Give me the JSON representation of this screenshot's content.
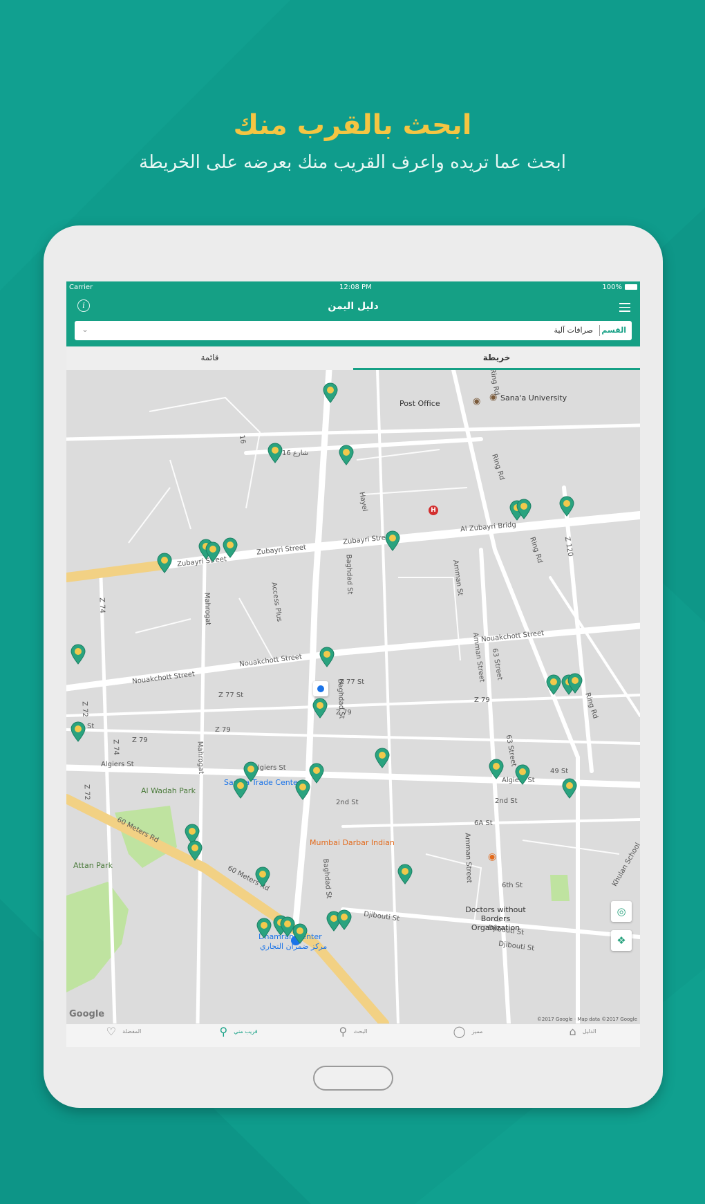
{
  "promo": {
    "title": "ابحث بالقرب منك",
    "subtitle": "ابحث عما تريده واعرف القريب منك بعرضه على الخريطة"
  },
  "status_bar": {
    "carrier": "Carrier",
    "time": "12:08 PM",
    "battery": "100%"
  },
  "app": {
    "title": "دليل اليمن",
    "info_icon": "info-icon",
    "menu_icon": "hamburger-menu-icon"
  },
  "search": {
    "category_label": "القسم",
    "value": "صرافات آلية",
    "dropdown_icon": "chevron-down-icon"
  },
  "tabs": {
    "map": "خريطة",
    "list": "قائمة",
    "active": "map"
  },
  "map": {
    "streets": [
      "Zubayri Street",
      "Zubayri Street",
      "Zubayri Street",
      "Al Zubayri Bridg",
      "Nouakchott Street",
      "Nouakchott Street",
      "Nouakchott Street",
      "Algiers St",
      "Algiers St",
      "Algiers St",
      "60 Meters Rd",
      "60 Meters Rd",
      "Djibouti St",
      "Djibouti St",
      "Djibouti St",
      "Z 77 St",
      "Z 77 St",
      "Z 79",
      "Z 79",
      "Z 79",
      "Z 79",
      "2nd St",
      "2nd St",
      "6A St",
      "6th St",
      "49 St",
      "Ring Rd",
      "Ring Rd",
      "Ring Rd",
      "Ring Rd",
      "Hayel",
      "Baghdad St",
      "Baghdad St",
      "Baghdad St",
      "Amman St",
      "Amman Street",
      "Amman Street",
      "Access Plus",
      "Mahrogat",
      "Mahrogat",
      "Z 74",
      "Z 74",
      "Z 72",
      "Z 72",
      "Z 120",
      "63 Street",
      "63 Street",
      "Khulan School",
      "16",
      "شارع 16",
      "St"
    ],
    "pois": [
      "Post Office",
      "Sana'a University",
      "Sana'a Trade Center",
      "Mumbai Darbar Indian",
      "Doctors without Borders Organization",
      "Dhamran Center",
      "مركز ضمران التجاري",
      "Al Wadah Park",
      "Attan Park"
    ],
    "google_logo": "Google",
    "attribution": "©2017 Google · Map data ©2017 Google",
    "controls": [
      "compass-icon",
      "my-location-icon"
    ],
    "pin_color": "#2aa37f",
    "pin_dot_color": "#f2c94c"
  },
  "bottom_nav": [
    {
      "label": "الدليل",
      "icon": "home-icon",
      "active": false
    },
    {
      "label": "مميز",
      "icon": "award-icon",
      "active": false
    },
    {
      "label": "البحث",
      "icon": "search-icon",
      "active": false
    },
    {
      "label": "قريب مني",
      "icon": "location-person-icon",
      "active": true
    },
    {
      "label": "المفضلة",
      "icon": "heart-icon",
      "active": false
    }
  ],
  "colors": {
    "background": "#0f9c8c",
    "accent": "#15a085",
    "title": "#f5c542"
  }
}
